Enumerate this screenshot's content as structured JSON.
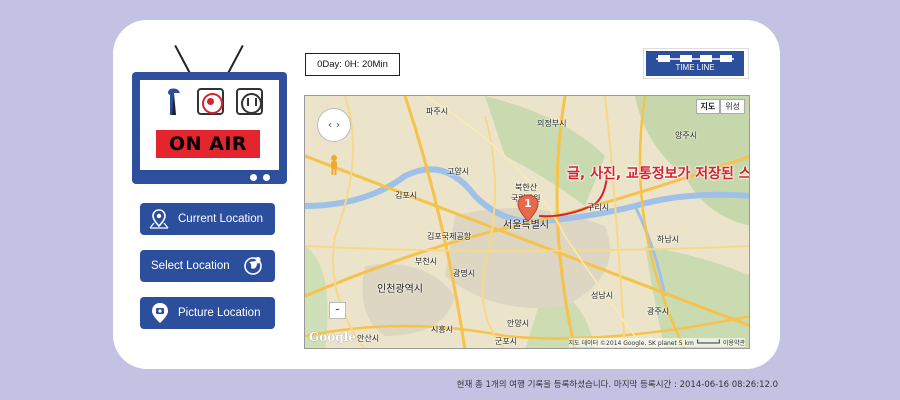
{
  "app": {
    "tv": {
      "on_air_label": "ON AIR",
      "antenna_icon": "antenna-icon",
      "record_icon": "record-icon",
      "pause_icon": "pause-icon"
    },
    "buttons": [
      {
        "label": "Current Location",
        "icon": "map-pin-icon"
      },
      {
        "label": "Select Location",
        "icon": "globe-pin-icon"
      },
      {
        "label": "Picture Location",
        "icon": "photo-pin-icon"
      }
    ],
    "timer": "0Day: 0H: 20Min",
    "timeline_label": "TIME LINE",
    "colors": {
      "accent": "#2b4f9d",
      "on_air": "#e3252d",
      "background": "#c4c2e2",
      "annotation": "#d8222b"
    }
  },
  "map": {
    "type_buttons": [
      "지도",
      "위성"
    ],
    "zoom_out": "-",
    "cities": [
      {
        "name": "파주시"
      },
      {
        "name": "의정부시"
      },
      {
        "name": "양주시"
      },
      {
        "name": "고양시"
      },
      {
        "name": "김포시"
      },
      {
        "name": "북한산"
      },
      {
        "name": "국립공원"
      },
      {
        "name": "구리시"
      },
      {
        "name": "서울특별시"
      },
      {
        "name": "하남시"
      },
      {
        "name": "김포국제공항"
      },
      {
        "name": "부천시"
      },
      {
        "name": "광명시"
      },
      {
        "name": "인천광역시"
      },
      {
        "name": "안양시"
      },
      {
        "name": "성남시"
      },
      {
        "name": "광주시"
      },
      {
        "name": "시흥시"
      },
      {
        "name": "군포시"
      },
      {
        "name": "안산시"
      }
    ],
    "marker_number": "1",
    "annotation": "글, 사진, 교통정보가 저장된 스팟",
    "google_logo": "Google",
    "copyright": "지도 데이터 ©2014 Google, SK planet   5 km ┗━━━━━┛  이용약관"
  },
  "status_text": "현재 총 1개의 여행 기록을 등록하셨습니다. 마지막 등록시간 : 2014-06-16 08:26:12.0"
}
